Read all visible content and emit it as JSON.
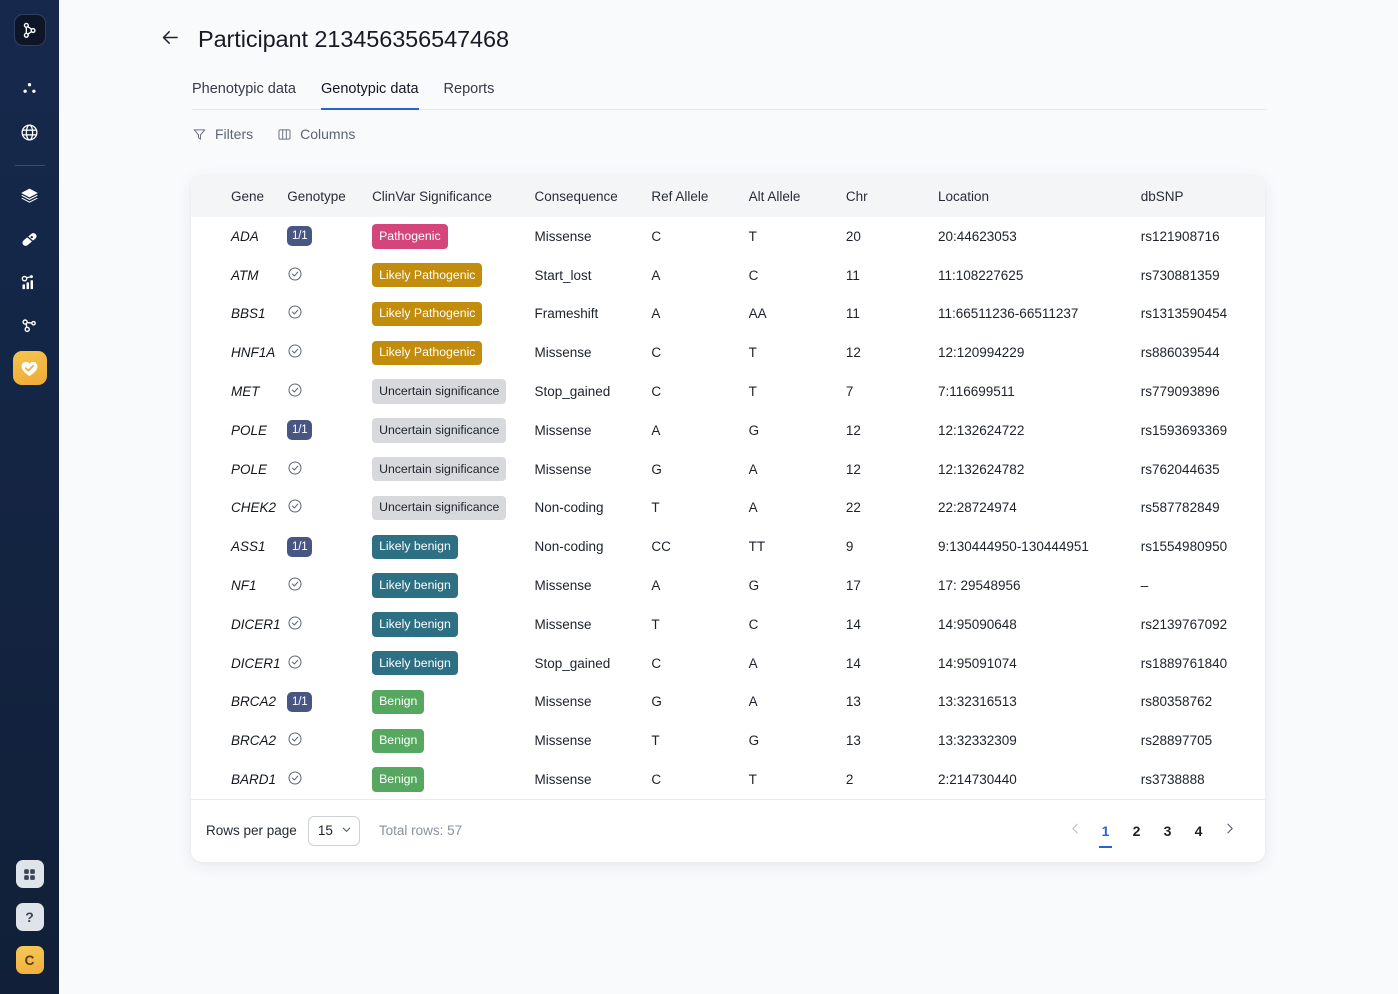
{
  "sidebar": {
    "logo": "node-graph-logo",
    "items": [
      {
        "icon": "cluster-dots-icon",
        "name": "cohorts"
      },
      {
        "icon": "globe-icon",
        "name": "population"
      },
      {
        "icon": "layers-icon",
        "name": "datasets"
      },
      {
        "icon": "pill-icon",
        "name": "drugs"
      },
      {
        "icon": "analytics-node-icon",
        "name": "analytics"
      },
      {
        "icon": "molecule-graph-icon",
        "name": "variants"
      },
      {
        "icon": "heart-shield-icon",
        "name": "participants",
        "active": true
      }
    ],
    "bottom": [
      {
        "icon": "apps-grid-icon",
        "name": "apps",
        "label": ""
      },
      {
        "icon": "help-icon",
        "name": "help",
        "label": "?"
      },
      {
        "icon": "avatar",
        "name": "user-avatar",
        "label": "C"
      }
    ]
  },
  "header": {
    "back_icon": "arrow-left-icon",
    "title": "Participant",
    "participant_id": "213456356547468"
  },
  "tabs": [
    {
      "label": "Phenotypic data",
      "active": false
    },
    {
      "label": "Genotypic data",
      "active": true
    },
    {
      "label": "Reports",
      "active": false
    }
  ],
  "toolbar": {
    "filters_label": "Filters",
    "filters_icon": "funnel-icon",
    "columns_label": "Columns",
    "columns_icon": "columns-icon"
  },
  "table": {
    "columns": [
      "Gene",
      "Genotype",
      "ClinVar Significance",
      "Consequence",
      "Ref Allele",
      "Alt Allele",
      "Chr",
      "Location",
      "dbSNP"
    ],
    "rows": [
      {
        "gene": "ADA",
        "genotype": "1/1",
        "genotype_type": "chip",
        "significance": "Pathogenic",
        "sig_class": "pathogenic",
        "consequence": "Missense",
        "ref": "C",
        "alt": "T",
        "chr": "20",
        "location": "20:44623053",
        "dbsnp": "rs121908716"
      },
      {
        "gene": "ATM",
        "genotype": "",
        "genotype_type": "check",
        "significance": "Likely Pathogenic",
        "sig_class": "likely-pathogenic",
        "consequence": "Start_lost",
        "ref": "A",
        "alt": "C",
        "chr": "11",
        "location": "11:108227625",
        "dbsnp": "rs730881359"
      },
      {
        "gene": "BBS1",
        "genotype": "",
        "genotype_type": "check",
        "significance": "Likely Pathogenic",
        "sig_class": "likely-pathogenic",
        "consequence": "Frameshift",
        "ref": "A",
        "alt": "AA",
        "chr": "11",
        "location": "11:66511236-66511237",
        "dbsnp": "rs1313590454"
      },
      {
        "gene": "HNF1A",
        "genotype": "",
        "genotype_type": "check",
        "significance": "Likely Pathogenic",
        "sig_class": "likely-pathogenic",
        "consequence": "Missense",
        "ref": "C",
        "alt": "T",
        "chr": "12",
        "location": "12:120994229",
        "dbsnp": "rs886039544"
      },
      {
        "gene": "MET",
        "genotype": "",
        "genotype_type": "check",
        "significance": "Uncertain significance",
        "sig_class": "uncertain",
        "consequence": "Stop_gained",
        "ref": "C",
        "alt": "T",
        "chr": "7",
        "location": "7:116699511",
        "dbsnp": "rs779093896"
      },
      {
        "gene": "POLE",
        "genotype": "1/1",
        "genotype_type": "chip",
        "significance": "Uncertain significance",
        "sig_class": "uncertain",
        "consequence": "Missense",
        "ref": "A",
        "alt": "G",
        "chr": "12",
        "location": "12:132624722",
        "dbsnp": "rs1593693369"
      },
      {
        "gene": "POLE",
        "genotype": "",
        "genotype_type": "check",
        "significance": "Uncertain significance",
        "sig_class": "uncertain",
        "consequence": "Missense",
        "ref": "G",
        "alt": "A",
        "chr": "12",
        "location": "12:132624782",
        "dbsnp": "rs762044635"
      },
      {
        "gene": "CHEK2",
        "genotype": "",
        "genotype_type": "check",
        "significance": "Uncertain significance",
        "sig_class": "uncertain",
        "consequence": "Non-coding",
        "ref": "T",
        "alt": "A",
        "chr": "22",
        "location": "22:28724974",
        "dbsnp": "rs587782849"
      },
      {
        "gene": "ASS1",
        "genotype": "1/1",
        "genotype_type": "chip",
        "significance": "Likely benign",
        "sig_class": "likely-benign",
        "consequence": "Non-coding",
        "ref": "CC",
        "alt": "TT",
        "chr": "9",
        "location": "9:130444950-130444951",
        "dbsnp": "rs1554980950"
      },
      {
        "gene": "NF1",
        "genotype": "",
        "genotype_type": "check",
        "significance": "Likely benign",
        "sig_class": "likely-benign",
        "consequence": "Missense",
        "ref": "A",
        "alt": "G",
        "chr": "17",
        "location": "17: 29548956",
        "dbsnp": "–"
      },
      {
        "gene": "DICER1",
        "genotype": "",
        "genotype_type": "check",
        "significance": "Likely benign",
        "sig_class": "likely-benign",
        "consequence": "Missense",
        "ref": "T",
        "alt": "C",
        "chr": "14",
        "location": "14:95090648",
        "dbsnp": "rs2139767092"
      },
      {
        "gene": "DICER1",
        "genotype": "",
        "genotype_type": "check",
        "significance": "Likely benign",
        "sig_class": "likely-benign",
        "consequence": "Stop_gained",
        "ref": "C",
        "alt": "A",
        "chr": "14",
        "location": "14:95091074",
        "dbsnp": "rs1889761840"
      },
      {
        "gene": "BRCA2",
        "genotype": "1/1",
        "genotype_type": "chip",
        "significance": "Benign",
        "sig_class": "benign",
        "consequence": "Missense",
        "ref": "G",
        "alt": "A",
        "chr": "13",
        "location": "13:32316513",
        "dbsnp": "rs80358762"
      },
      {
        "gene": "BRCA2",
        "genotype": "",
        "genotype_type": "check",
        "significance": "Benign",
        "sig_class": "benign",
        "consequence": "Missense",
        "ref": "T",
        "alt": "G",
        "chr": "13",
        "location": "13:32332309",
        "dbsnp": "rs28897705"
      },
      {
        "gene": "BARD1",
        "genotype": "",
        "genotype_type": "check",
        "significance": "Benign",
        "sig_class": "benign",
        "consequence": "Missense",
        "ref": "C",
        "alt": "T",
        "chr": "2",
        "location": "2:214730440",
        "dbsnp": "rs3738888"
      }
    ]
  },
  "footer": {
    "rows_per_page_label": "Rows per page",
    "rows_per_page_value": "15",
    "total_rows_label": "Total rows: 57",
    "prev_icon": "chevron-left-icon",
    "next_icon": "chevron-right-icon",
    "pages": [
      "1",
      "2",
      "3",
      "4"
    ],
    "current_page": "1"
  },
  "colors": {
    "accent": "#2563d9",
    "pathogenic": "#d4467b",
    "likely_pathogenic": "#c28c0d",
    "uncertain": "#d7d9dd",
    "likely_benign": "#2e7083",
    "benign": "#56a861",
    "genotype_chip": "#475682",
    "sidebar": "#142648",
    "highlight": "#f0ae3c"
  }
}
